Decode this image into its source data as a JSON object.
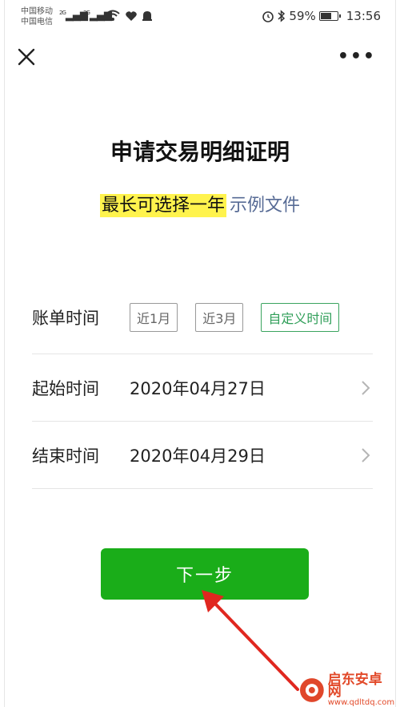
{
  "status_bar": {
    "carrier_1": "中国移动",
    "carrier_2": "中国电信",
    "sig_1": "2G",
    "sig_2": "3G",
    "battery": "59%",
    "battery_level": 0.59,
    "time": "13:56"
  },
  "nav": {
    "close_icon": "close-icon",
    "more_label": "•••"
  },
  "page": {
    "title": "申请交易明细证明",
    "highlight_text": "最长可选择一年",
    "sample_link": "示例文件"
  },
  "form": {
    "bill_time": {
      "label": "账单时间",
      "options": [
        "近1月",
        "近3月",
        "自定义时间"
      ],
      "selected": "自定义时间"
    },
    "start_time": {
      "label": "起始时间",
      "value": "2020年04月27日"
    },
    "end_time": {
      "label": "结束时间",
      "value": "2020年04月29日"
    }
  },
  "next_button": "下一步",
  "watermark": {
    "name": "启东安卓网",
    "url": "www.qdltdq.com"
  },
  "colors": {
    "primary_green": "#1aad19",
    "chip_active": "#2f9e58",
    "link": "#576b95",
    "highlight": "#fff34d",
    "annotation_red": "#e0271f"
  }
}
